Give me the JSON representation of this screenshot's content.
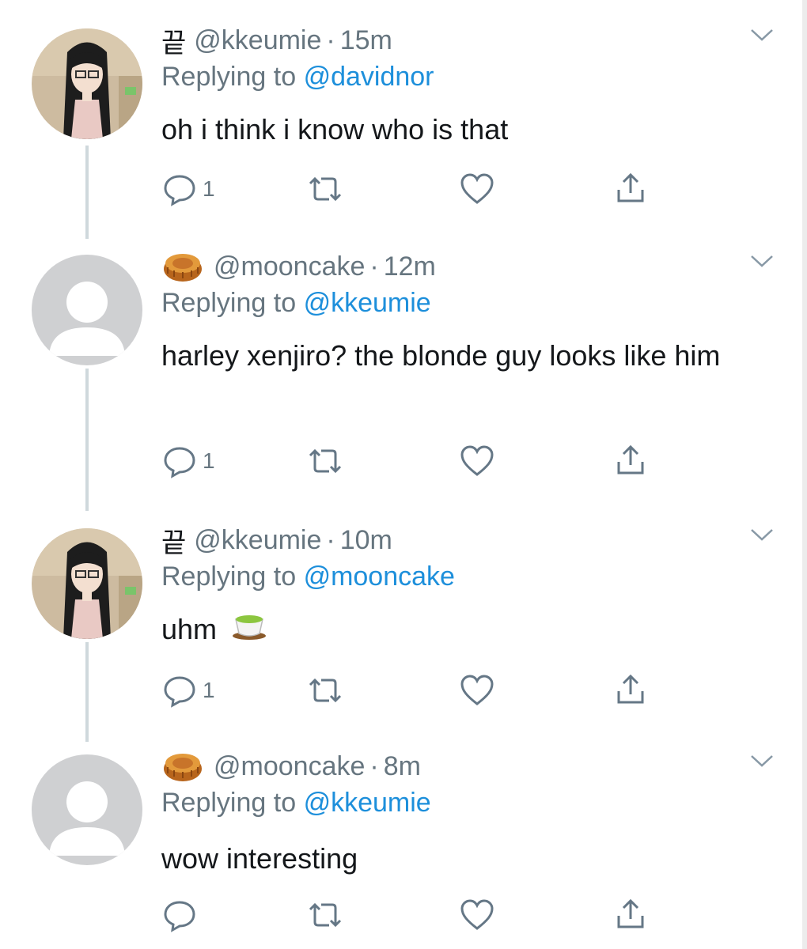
{
  "tweets": [
    {
      "display_name": "끝",
      "handle": "@kkeumie",
      "time": "15m",
      "replying_label": "Replying to",
      "replying_to": "@davidnor",
      "text": "oh i think i know who is that",
      "reply_count": "1",
      "avatar": "anime-girl-avatar",
      "name_icon": ""
    },
    {
      "display_name": "",
      "handle": "@mooncake",
      "time": "12m",
      "replying_label": "Replying to",
      "replying_to": "@kkeumie",
      "text": "harley xenjiro? the blonde guy looks like him",
      "reply_count": "1",
      "avatar": "default-avatar",
      "name_icon": "mooncake-emoji"
    },
    {
      "display_name": "끝",
      "handle": "@kkeumie",
      "time": "10m",
      "replying_label": "Replying to",
      "replying_to": "@mooncake",
      "text": "uhm",
      "text_emoji": "tea-emoji",
      "reply_count": "1",
      "avatar": "anime-girl-avatar",
      "name_icon": ""
    },
    {
      "display_name": "",
      "handle": "@mooncake",
      "time": "8m",
      "replying_label": "Replying to",
      "replying_to": "@kkeumie",
      "text": "wow interesting",
      "reply_count": "",
      "avatar": "default-avatar",
      "name_icon": "mooncake-emoji"
    }
  ],
  "separator": "·",
  "colors": {
    "text": "#14171a",
    "muted": "#66757f",
    "link": "#1d8fdb",
    "connector": "#cfd8dc",
    "icon": "#657786"
  },
  "icons": [
    "reply-icon",
    "retweet-icon",
    "like-icon",
    "share-icon",
    "chevron-down-icon"
  ]
}
